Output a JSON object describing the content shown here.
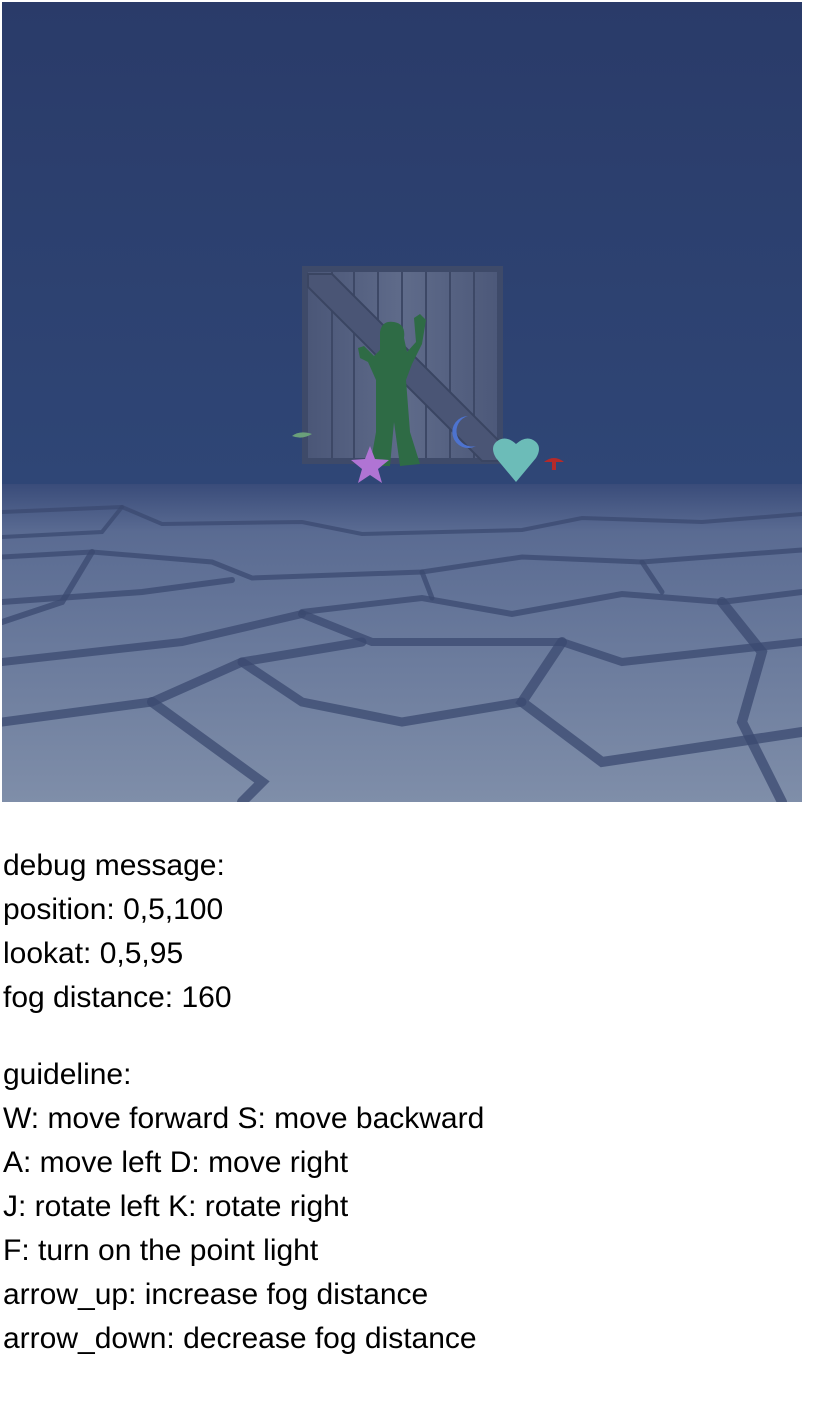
{
  "scene": {
    "sky_color": "#2b3d6a",
    "floor_color": "#6c7c9d",
    "objects": [
      {
        "name": "wooden-crate",
        "color": "#5c6a85"
      },
      {
        "name": "gumby-figure",
        "color": "#2d6a45"
      },
      {
        "name": "star-shape",
        "color": "#b074d4"
      },
      {
        "name": "moon-shape",
        "color": "#4d73cf"
      },
      {
        "name": "heart-shape",
        "color": "#6cbcb8"
      },
      {
        "name": "mushroom-shape",
        "color": "#b42a2a"
      },
      {
        "name": "leaf-shape",
        "color": "#6aa07a"
      }
    ]
  },
  "debug": {
    "header": "debug message:",
    "position": "position: 0,5,100",
    "lookat": "lookat: 0,5,95",
    "fog": "fog distance: 160"
  },
  "guideline": {
    "header": "guideline:",
    "lines": [
      "W: move forward S: move backward",
      "A: move left D: move right",
      "J: rotate left K: rotate right",
      "F: turn on the point light",
      "arrow_up: increase fog distance",
      "arrow_down: decrease fog distance"
    ]
  }
}
